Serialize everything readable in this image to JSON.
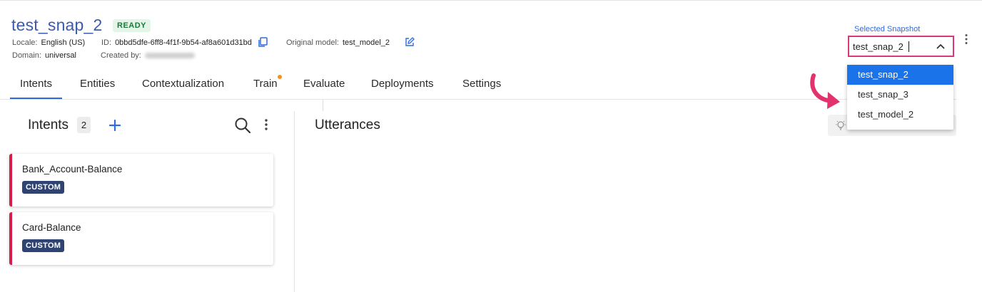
{
  "header": {
    "title": "test_snap_2",
    "status": "READY",
    "locale_label": "Locale:",
    "locale_value": "English (US)",
    "id_label": "ID:",
    "id_value": "0bbd5dfe-6ff8-4f1f-9b54-af8a601d31bd",
    "original_model_label": "Original model:",
    "original_model_value": "test_model_2",
    "domain_label": "Domain:",
    "domain_value": "universal",
    "created_by_label": "Created by:"
  },
  "tabs": [
    {
      "label": "Intents",
      "active": true
    },
    {
      "label": "Entities"
    },
    {
      "label": "Contextualization"
    },
    {
      "label": "Train",
      "notification": true
    },
    {
      "label": "Evaluate"
    },
    {
      "label": "Deployments"
    },
    {
      "label": "Settings"
    }
  ],
  "intents_panel": {
    "title": "Intents",
    "count": "2",
    "items": [
      {
        "name": "Bank_Account-Balance",
        "badge": "CUSTOM"
      },
      {
        "name": "Card-Balance",
        "badge": "CUSTOM"
      }
    ]
  },
  "utterances_panel": {
    "title": "Utterances"
  },
  "snapshot_selector": {
    "label": "Selected Snapshot",
    "value": "test_snap_2",
    "options": [
      "test_snap_2",
      "test_snap_3",
      "test_model_2"
    ],
    "selected_index": 0
  },
  "colors": {
    "title": "#3d5ba9",
    "accent": "#2f6bdf",
    "highlight_border": "#d8397a",
    "card_stripe": "#d51e4a",
    "badge_bg": "#2e4372",
    "status_bg": "#e3f5e6",
    "notification_dot": "#f2931b"
  },
  "icons": [
    "copy-icon",
    "edit-icon",
    "plus-icon",
    "search-icon",
    "more-vert-icon",
    "chevron-up-icon",
    "curved-arrow-icon",
    "lightbulb-icon"
  ]
}
